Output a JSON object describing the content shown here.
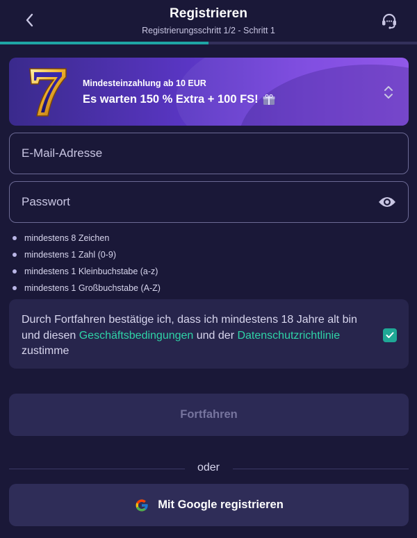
{
  "header": {
    "title": "Registrieren",
    "subtitle": "Registrierungsschritt 1/2 - Schritt 1",
    "back_icon": "chevron-left-icon",
    "support_icon": "headset-support-icon"
  },
  "progress": {
    "fraction": 0.5,
    "color": "#1fa5a5"
  },
  "banner": {
    "small_text": "Mindesteinzahlung ab 10 EUR",
    "big_text": "Es warten 150 % Extra + 100 FS!",
    "logo_icon": "lucky-seven-icon",
    "gift_icon": "gift-icon",
    "expand_icon": "chevron-up-down-icon"
  },
  "form": {
    "email_placeholder": "E-Mail-Adresse",
    "email_value": "",
    "password_placeholder": "Passwort",
    "password_value": "",
    "eye_icon": "eye-icon"
  },
  "password_rules": [
    "mindestens 8 Zeichen",
    "mindestens 1 Zahl (0-9)",
    "mindestens 1 Kleinbuchstabe (a-z)",
    "mindestens 1 Großbuchstabe (A-Z)"
  ],
  "consent": {
    "text_1": "Durch Fortfahren bestätige ich, dass ich mindestens 18 Jahre alt bin und diesen ",
    "link_terms": "Geschäftsbedingungen",
    "text_2": " und der ",
    "link_privacy": "Datenschutzrichtlinie",
    "text_3": " zustimme",
    "checked": true
  },
  "buttons": {
    "continue_label": "Fortfahren",
    "divider_label": "oder",
    "google_label": "Mit Google registrieren",
    "google_icon": "google-g-icon"
  },
  "colors": {
    "background": "#1a1838",
    "accent_teal": "#1fa5a5",
    "link_green": "#2fd4a8",
    "banner_purple": "#5a36c4"
  }
}
